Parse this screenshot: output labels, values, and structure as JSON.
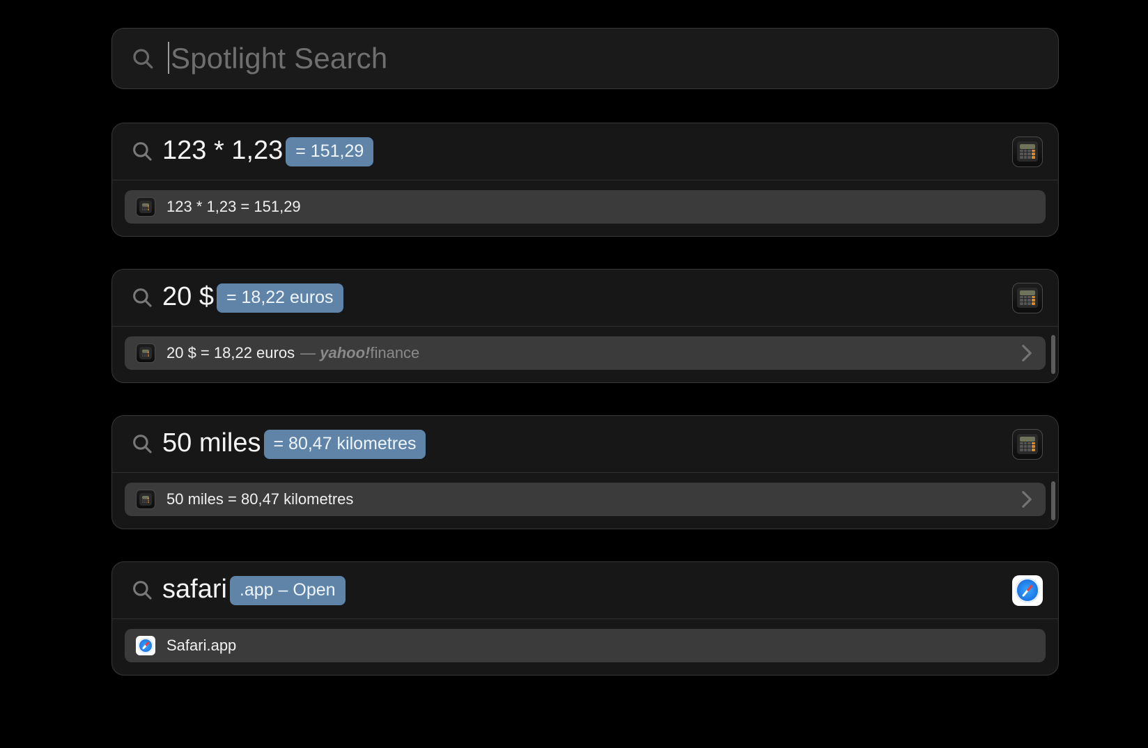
{
  "search": {
    "placeholder": "Spotlight Search",
    "value": ""
  },
  "panels": [
    {
      "query": "123 * 1,23",
      "badge": "= 151,29",
      "top_icon": "calculator",
      "result_icon": "calculator",
      "result_text": "123 * 1,23 = 151,29",
      "source": "",
      "chevron": false,
      "side_scroll": false
    },
    {
      "query": "20 $",
      "badge": "= 18,22 euros",
      "top_icon": "calculator",
      "result_icon": "calculator",
      "result_text": "20 $ = 18,22 euros",
      "source_prefix": " — ",
      "source_brand1": "yahoo!",
      "source_brand2": "finance",
      "chevron": true,
      "side_scroll": true
    },
    {
      "query": "50 miles",
      "badge": "= 80,47 kilometres",
      "top_icon": "calculator",
      "result_icon": "calculator",
      "result_text": "50 miles = 80,47 kilometres",
      "source": "",
      "chevron": true,
      "side_scroll": true
    },
    {
      "query": "safari",
      "badge": ".app – Open",
      "top_icon": "safari",
      "result_icon": "safari",
      "result_text": "Safari.app",
      "source": "",
      "chevron": false,
      "side_scroll": false
    }
  ]
}
